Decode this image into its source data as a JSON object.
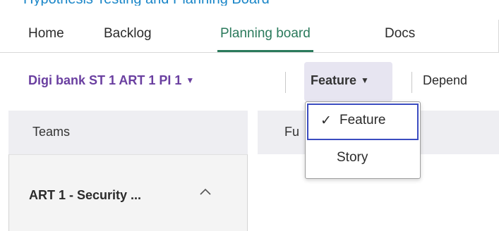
{
  "page_heading": "Hypothesis Testing and Planning Board",
  "nav": {
    "tabs": [
      {
        "label": "Home",
        "active": false
      },
      {
        "label": "Backlog",
        "active": false
      },
      {
        "label": "Planning board",
        "active": true
      },
      {
        "label": "Docs",
        "active": false
      }
    ]
  },
  "toolbar": {
    "pi_select": "Digi bank ST 1 ART 1 PI 1",
    "type_select": "Feature",
    "dependencies": "Depend"
  },
  "dropdown": {
    "options": [
      {
        "label": "Feature",
        "selected": true
      },
      {
        "label": "Story",
        "selected": false
      }
    ]
  },
  "board": {
    "teams_header": "Teams",
    "features_header": "Fu",
    "team_row": "ART 1 - Security ..."
  },
  "colors": {
    "accent_purple": "#6a3fa0",
    "active_tab_green": "#2b7a5c",
    "selection_border": "#3b4cc0",
    "header_blue": "#1a86c8"
  }
}
